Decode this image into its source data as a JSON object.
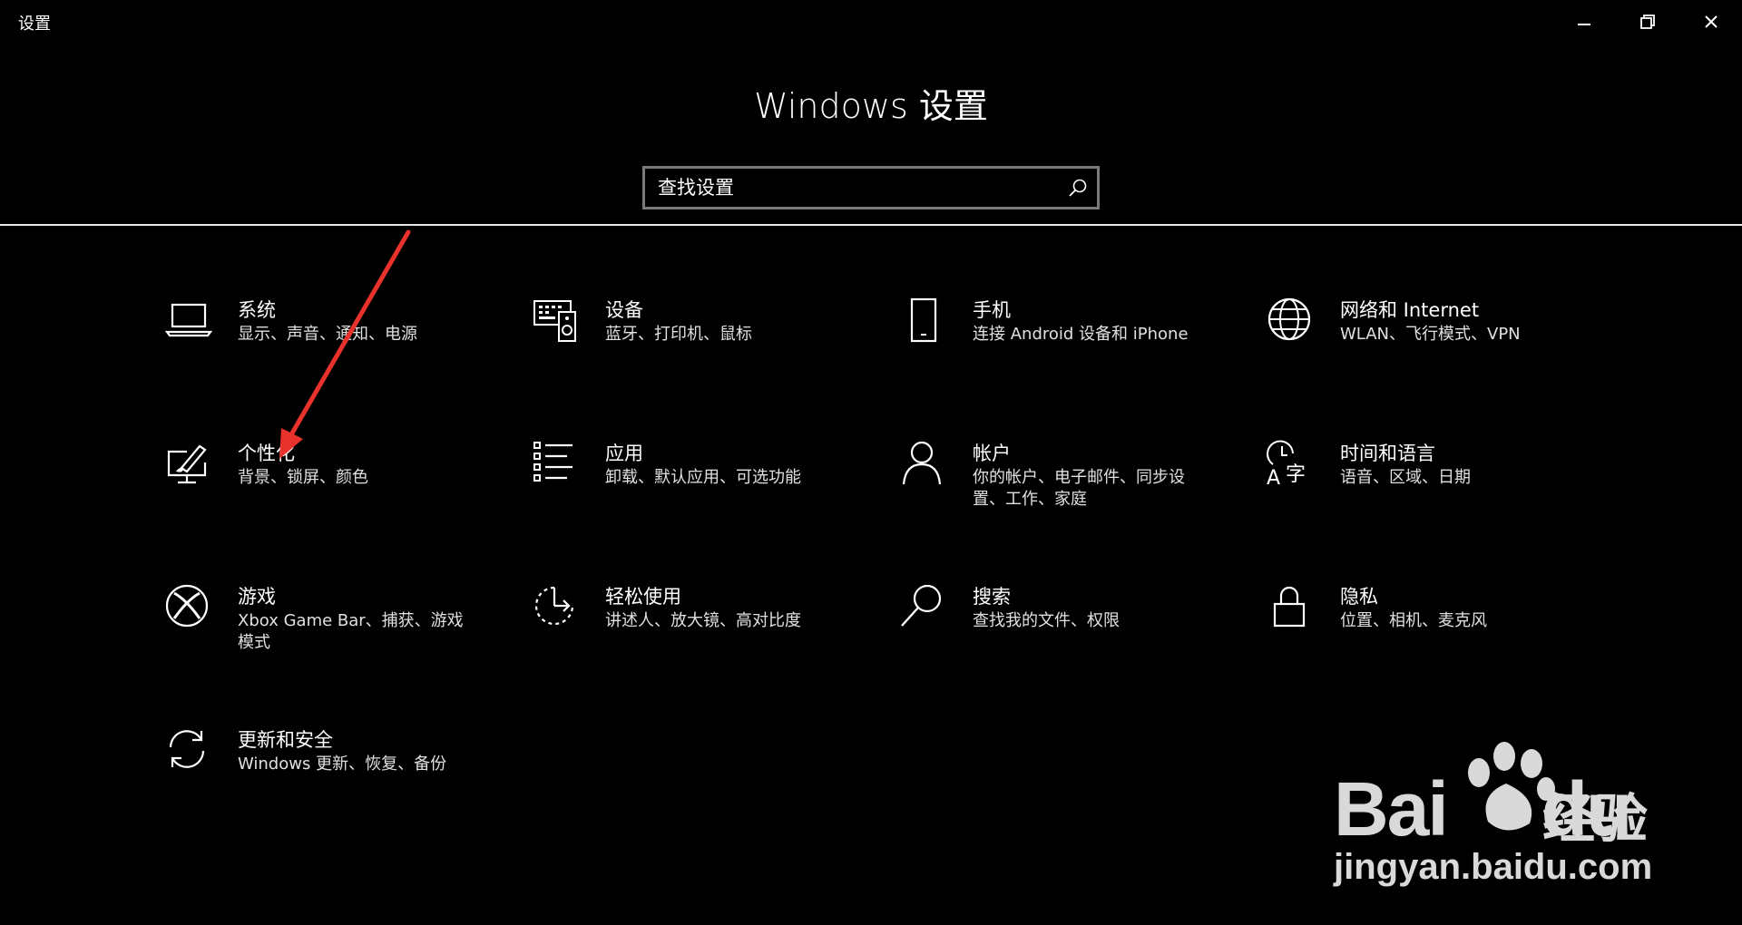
{
  "window": {
    "title": "设置",
    "minimize_label": "minimize",
    "maximize_label": "restore",
    "close_label": "close"
  },
  "header": {
    "title": "Windows 设置"
  },
  "search": {
    "placeholder": "查找设置",
    "icon": "search-icon"
  },
  "tiles": [
    {
      "title": "系统",
      "desc": "显示、声音、通知、电源",
      "icon": "laptop-icon"
    },
    {
      "title": "设备",
      "desc": "蓝牙、打印机、鼠标",
      "icon": "devices-icon"
    },
    {
      "title": "手机",
      "desc": "连接 Android 设备和 iPhone",
      "icon": "phone-icon"
    },
    {
      "title": "网络和 Internet",
      "desc": "WLAN、飞行模式、VPN",
      "icon": "globe-icon"
    },
    {
      "title": "个性化",
      "desc": "背景、锁屏、颜色",
      "icon": "personalization-icon"
    },
    {
      "title": "应用",
      "desc": "卸载、默认应用、可选功能",
      "icon": "apps-list-icon"
    },
    {
      "title": "帐户",
      "desc": "你的帐户、电子邮件、同步设置、工作、家庭",
      "icon": "person-icon"
    },
    {
      "title": "时间和语言",
      "desc": "语音、区域、日期",
      "icon": "time-language-icon"
    },
    {
      "title": "游戏",
      "desc": "Xbox Game Bar、捕获、游戏模式",
      "icon": "xbox-icon"
    },
    {
      "title": "轻松使用",
      "desc": "讲述人、放大镜、高对比度",
      "icon": "ease-of-access-icon"
    },
    {
      "title": "搜索",
      "desc": "查找我的文件、权限",
      "icon": "magnifier-icon"
    },
    {
      "title": "隐私",
      "desc": "位置、相机、麦克风",
      "icon": "lock-icon"
    },
    {
      "title": "更新和安全",
      "desc": "Windows 更新、恢复、备份",
      "icon": "sync-icon"
    }
  ],
  "annotation": {
    "arrow_color": "#e8322b"
  },
  "watermark": {
    "brand": "Bai",
    "brand2": "du",
    "cn": "经验",
    "url": "jingyan.baidu.com"
  }
}
